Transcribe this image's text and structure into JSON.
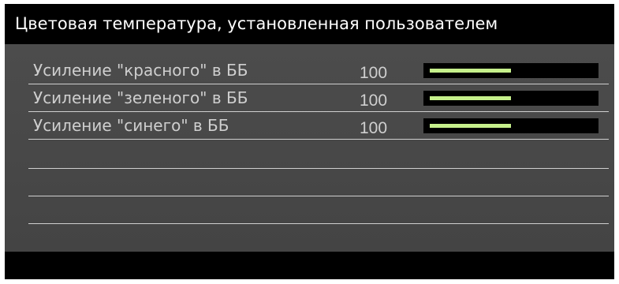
{
  "header": {
    "title": "Цветовая температура, установленная пользователем"
  },
  "settings": [
    {
      "label": "Усиление \"красного\" в ББ",
      "value": "100",
      "level": 0.5
    },
    {
      "label": "Усиление \"зеленого\" в ББ",
      "value": "100",
      "level": 0.5
    },
    {
      "label": "Усиление \"синего\" в ББ",
      "value": "100",
      "level": 0.5
    }
  ],
  "colors": {
    "background": "#4a4a4a",
    "header_background": "#000000",
    "text": "#cfcfcf",
    "slider_track": "#000000",
    "slider_fill": "#c6f08c"
  }
}
